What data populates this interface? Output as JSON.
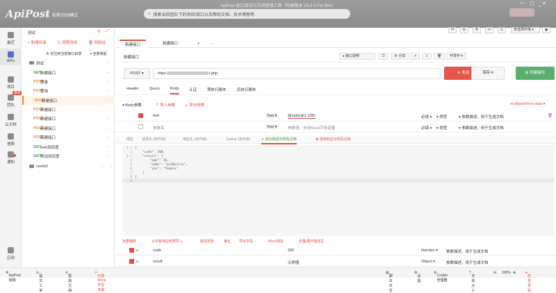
{
  "app": {
    "logo": "ApiPost",
    "theme_toggle": "炭黑/日间模式",
    "window_title": "ApiPost 接口调试与文档管理工具（构建版本 V3.2.3 For Win）",
    "search_placeholder": "搜索当前团队下的项目/接口以及帮助文档、技术博客等."
  },
  "rail": {
    "items": [
      {
        "label": "最近"
      },
      {
        "label": "APIs"
      },
      {
        "label": "项目"
      },
      {
        "label": "团队"
      },
      {
        "label": "云文档"
      },
      {
        "label": "搜索"
      },
      {
        "label": "通知"
      },
      {
        "label": "应用"
      }
    ],
    "team_badge": "邀请"
  },
  "tree": {
    "project_name": "测试",
    "new_dir": "新建目录",
    "flow_test": "流程测试",
    "recycle": "回收站",
    "locate": "定位到当前接口目录",
    "collapse": "全部收起",
    "folder_name": "测试",
    "items": [
      {
        "method": "GET",
        "name": "新建接口"
      },
      {
        "method": "POST",
        "name": "登录"
      },
      {
        "method": "POST",
        "name": "查询"
      },
      {
        "method": "POST",
        "name": "新建接口"
      },
      {
        "method": "POST",
        "name": "新建接口"
      },
      {
        "method": "POST",
        "name": "新建接口"
      },
      {
        "method": "POST",
        "name": "新建接口"
      },
      {
        "method": "POST",
        "name": "新建接口"
      },
      {
        "method": "GET",
        "name": "web测百度"
      },
      {
        "method": "GET",
        "name": "移动测百度"
      }
    ],
    "folder2": "cesHiZ"
  },
  "toolbar": {
    "buttons": [
      "H",
      "G",
      "B",
      "<>",
      "三"
    ],
    "env_select": "未选择环境",
    "tab1": "新建接口",
    "tab2": "新建接口",
    "add_tab": "+",
    "more_tab": "···"
  },
  "request": {
    "name": "新建接口",
    "interface_status": "接口说明",
    "share": "分享",
    "dev_status": "开发中",
    "method": "POST",
    "url_prefix": "https",
    "url_suffix": "t.php",
    "send": "发送",
    "save": "保存",
    "mock": "创建备份",
    "tabs": [
      "Header",
      "Query",
      "Body",
      "认证",
      "预执行脚本",
      "后执行脚本"
    ],
    "active_tab": "Body",
    "body_label": "Body参数",
    "import": "导入参数",
    "export": "导出参数",
    "content_type": "multipart/form-data",
    "params": [
      {
        "key": "test",
        "type": "Text",
        "value": "@natural(1,100)",
        "required": "必填",
        "dtype": "类型",
        "desc": "参数描述，用于生成文档"
      },
      {
        "key": "参数名",
        "type": "Text",
        "value": "参数值，支持Mock字段变量",
        "required": "必填",
        "dtype": "类型",
        "desc": "参数描述，用于生成文档"
      }
    ]
  },
  "response": {
    "tabs": [
      {
        "label": "响应"
      },
      {
        "label": "请求头 (未开启)"
      },
      {
        "label": "响应头 (未开启)"
      },
      {
        "label": "Cookie (未开启)"
      },
      {
        "label": "成功响应示例及文档"
      },
      {
        "label": "错误响应示例及文档"
      }
    ],
    "code_lines": [
      "{",
      "    \"code\": 200,",
      "    \"result\": {",
      "        \"age\": 10,",
      "        \"name\": \"pinRuiiin\",",
      "        \"sex\": \"female\"",
      "    }",
      "}",
      ""
    ],
    "actions": [
      "批量删除",
      "从现有响应结果导入",
      "属性校验",
      "美化",
      "导出字段",
      "Mock地址",
      "折叠/展开描述区"
    ],
    "params": [
      {
        "key": "code",
        "value": "200",
        "type": "Number",
        "desc": "参数描述，用于生成文档"
      },
      {
        "key": "result",
        "value": "示例值",
        "type": "Object",
        "desc": "参数描述，用于生成文档"
      }
    ]
  },
  "statusbar": {
    "left": [
      "ApiPost官网",
      "提交工单",
      "帮助文档",
      "内置Mock字段变量"
    ],
    "right": [
      "脚本日志",
      "设置",
      "Cookie管理器",
      "字体大小",
      "100%",
      "检查更新"
    ]
  }
}
